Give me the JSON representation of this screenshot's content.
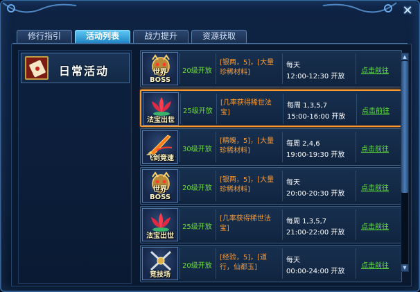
{
  "window": {
    "close_icon": "close-icon",
    "colors": {
      "accent": "#1f86c6",
      "highlight": "#ff9a2e",
      "level": "#6fdc3a",
      "link": "#5ee63a"
    }
  },
  "tabs": [
    {
      "label": "修行指引",
      "active": false
    },
    {
      "label": "活动列表",
      "active": true
    },
    {
      "label": "战力提升",
      "active": false
    },
    {
      "label": "资源获取",
      "active": false
    }
  ],
  "sidebar": {
    "items": [
      {
        "label": "日常活动",
        "icon": "scroll-icon"
      }
    ]
  },
  "activities": [
    {
      "icon": "world-boss-icon",
      "name": "世界BOSS",
      "level": "20级开放",
      "reward": "[银两，5]，[大量珍稀材料]",
      "days": "每天",
      "time": "12:00-12:30 开放",
      "action": "点击前往",
      "highlighted": false
    },
    {
      "icon": "lotus-icon",
      "name": "法宝出世",
      "level": "25级开放",
      "reward": "[几率获得稀世法宝]",
      "days": "每周 1,3,5,7",
      "time": "15:00-16:00 开放",
      "action": "点击前往",
      "highlighted": true
    },
    {
      "icon": "flying-sword-icon",
      "name": "飞剑竞速",
      "level": "30级开放",
      "reward": "[精魄，5]，[大量珍稀材料]",
      "days": "每周 2,4,6",
      "time": "19:00-19:30 开放",
      "action": "点击前往",
      "highlighted": false
    },
    {
      "icon": "world-boss-icon",
      "name": "世界BOSS",
      "level": "20级开放",
      "reward": "[银两，5]，[大量珍稀材料]",
      "days": "每天",
      "time": "20:00-20:30 开放",
      "action": "点击前往",
      "highlighted": false
    },
    {
      "icon": "lotus-icon",
      "name": "法宝出世",
      "level": "25级开放",
      "reward": "[几率获得稀世法宝]",
      "days": "每周 1,3,5,7",
      "time": "21:00-22:00 开放",
      "action": "点击前往",
      "highlighted": false
    },
    {
      "icon": "crossed-swords-icon",
      "name": "竞技场",
      "level": "20级开放",
      "reward": "[经验，5]，[道行，仙都玉]",
      "days": "每天",
      "time": "00:00-24:00 开放",
      "action": "点击前往",
      "highlighted": false
    }
  ],
  "scrollbar": {
    "up_icon": "arrow-up-icon",
    "down_icon": "arrow-down-icon"
  }
}
